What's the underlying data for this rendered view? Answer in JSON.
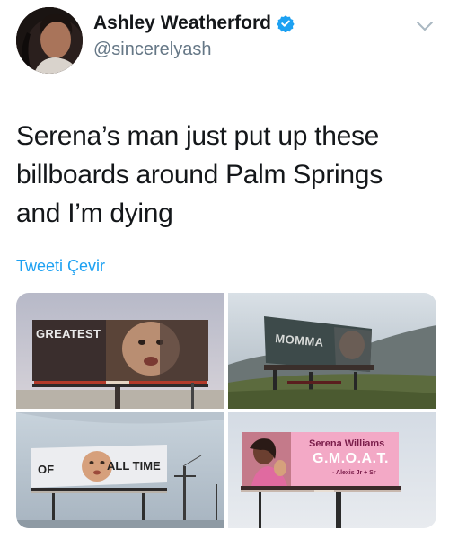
{
  "user": {
    "display_name": "Ashley Weatherford",
    "handle": "@sincerelyash",
    "verified_icon": "verified-badge-icon",
    "menu_icon": "chevron-down-icon"
  },
  "tweet": {
    "lines": [
      "Serena’s man just put up these",
      "billboards around Palm Springs",
      "and I’m dying"
    ],
    "translate_label": "Tweeti Çevir"
  },
  "media": {
    "photos": [
      {
        "billboard_text": "GREATEST"
      },
      {
        "billboard_text": "MOMMA"
      },
      {
        "billboard_text_left": "OF",
        "billboard_text_right": "ALL TIME"
      },
      {
        "name": "Serena Williams",
        "title": "G.M.O.A.T.",
        "signature": "- Alexis Jr + Sr"
      }
    ]
  },
  "colors": {
    "link": "#1da1f2",
    "secondary_text": "#657786",
    "primary_text": "#14171a",
    "billboard_pink": "#f3a9c6"
  }
}
